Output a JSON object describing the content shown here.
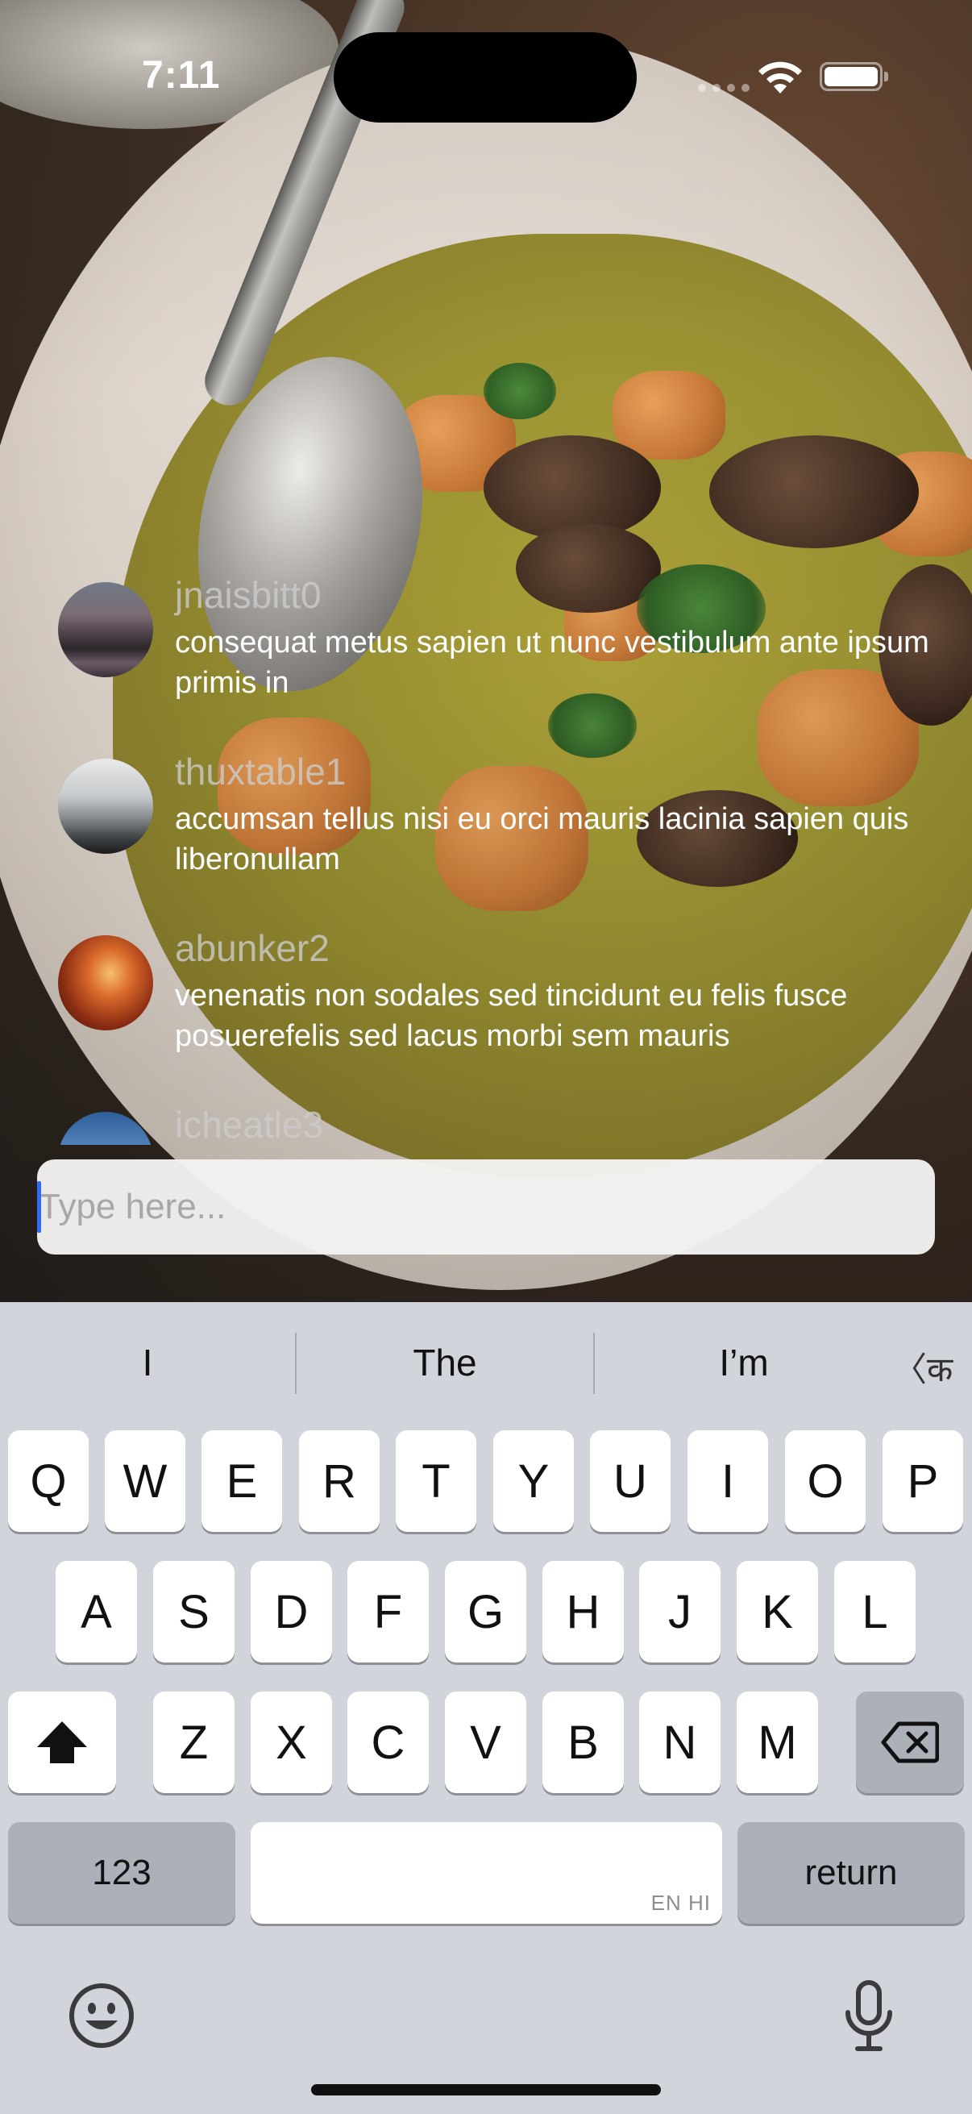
{
  "status_bar": {
    "time": "7:11"
  },
  "chat": {
    "messages": [
      {
        "username": "jnaisbitt0",
        "text": "consequat metus sapien ut nunc vestibulum ante ipsum primis in"
      },
      {
        "username": "thuxtable1",
        "text": "accumsan tellus nisi eu orci mauris lacinia sapien quis liberonullam"
      },
      {
        "username": "abunker2",
        "text": "venenatis non sodales sed tincidunt eu felis fusce posuerefelis sed lacus morbi sem mauris"
      },
      {
        "username": "icheatle3",
        "text": ""
      }
    ]
  },
  "input": {
    "placeholder": "Type here..."
  },
  "keyboard": {
    "suggestions": [
      "I",
      "The",
      "I’m"
    ],
    "lang_glyph": "〈क",
    "rows": [
      [
        "Q",
        "W",
        "E",
        "R",
        "T",
        "Y",
        "U",
        "I",
        "O",
        "P"
      ],
      [
        "A",
        "S",
        "D",
        "F",
        "G",
        "H",
        "J",
        "K",
        "L"
      ],
      [
        "Z",
        "X",
        "C",
        "V",
        "B",
        "N",
        "M"
      ]
    ],
    "numbers_label": "123",
    "return_label": "return",
    "space_lang_tag": "EN HI",
    "icons": {
      "shift": "shift-icon",
      "delete": "delete-icon",
      "emoji": "emoji-icon",
      "mic": "microphone-icon"
    }
  }
}
